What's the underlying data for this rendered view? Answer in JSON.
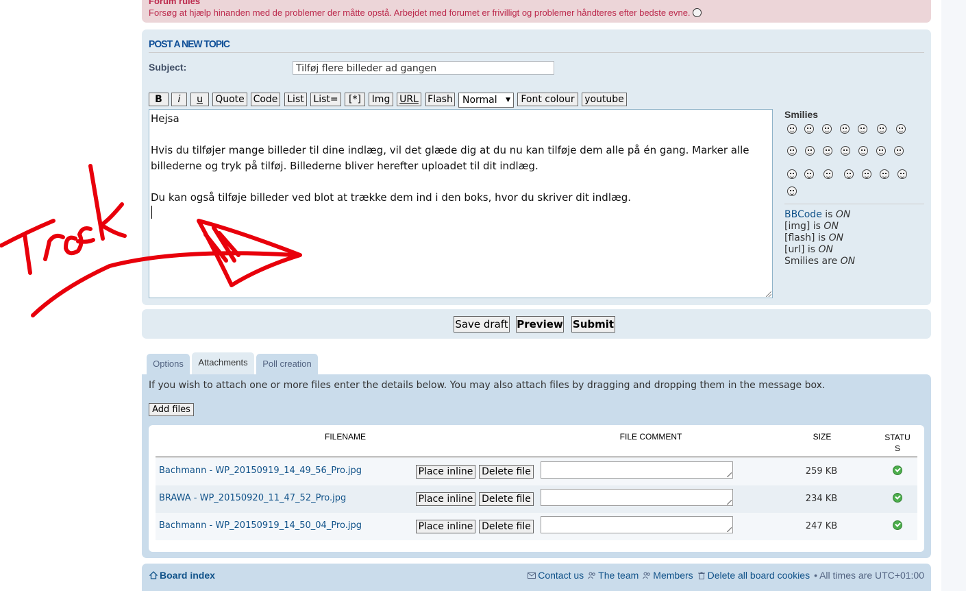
{
  "forum_rules": {
    "title": "Forum rules",
    "text": "Forsøg at hjælp hinanden med de problemer der måtte opstå. Arbejdet med forumet er frivilligt og problemer håndteres efter bedste evne."
  },
  "post": {
    "title": "POST A NEW TOPIC",
    "subject_label": "Subject:",
    "subject_value": "Tilføj flere billeder ad gangen",
    "toolbar": {
      "bold": "B",
      "italic": "i",
      "underline": "u",
      "quote": "Quote",
      "code": "Code",
      "list": "List",
      "list_ordered": "List=",
      "list_item": "[*]",
      "img": "Img",
      "url": "URL",
      "flash": "Flash",
      "font_size": "Normal",
      "font_colour": "Font colour",
      "youtube": "youtube"
    },
    "message_lines": [
      "Hejsa",
      "Hvis du tilføjer mange billeder til dine indlæg, vil det glæde dig at du nu kan tilføje dem alle på én gang. Marker alle",
      "billederne og tryk på tilføj. Billederne bliver herefter uploadet til dit indlæg.",
      "Du kan også tilføje billeder ved blot at trække dem ind i den boks, hvor du skriver dit indlæg."
    ],
    "smilies_title": "Smilies",
    "status": {
      "bbcode": "BBCode",
      "bbcode_suffix": " is ",
      "bbcode_state": "ON",
      "img": "[img] is ",
      "img_state": "ON",
      "flash": "[flash] is ",
      "flash_state": "ON",
      "url": "[url] is ",
      "url_state": "ON",
      "smilies": "Smilies are ",
      "smilies_state": "ON"
    }
  },
  "submit": {
    "save_draft": "Save draft",
    "preview": "Preview",
    "submit": "Submit"
  },
  "tabs": [
    "Options",
    "Attachments",
    "Poll creation"
  ],
  "attachments": {
    "info": "If you wish to attach one or more files enter the details below. You may also attach files by dragging and dropping them in the message box.",
    "add_files": "Add files",
    "headers": {
      "filename": "FILENAME",
      "comment": "FILE COMMENT",
      "size": "SIZE",
      "status": "STATU",
      "status2": "S"
    },
    "place_inline": "Place inline",
    "delete_file": "Delete file",
    "files": [
      {
        "name": "Bachmann - WP_20150919_14_49_56_Pro.jpg",
        "size": "259 KB"
      },
      {
        "name": "BRAWA - WP_20150920_11_47_52_Pro.jpg",
        "size": "234 KB"
      },
      {
        "name": "Bachmann - WP_20150919_14_50_04_Pro.jpg",
        "size": "247 KB"
      }
    ]
  },
  "footer": {
    "board_index": "Board index",
    "contact": "Contact us",
    "team": "The team",
    "members": "Members",
    "delete_cookies": "Delete all board cookies",
    "times": "• All times are UTC+01:00"
  },
  "annotation": {
    "text": "Træk",
    "color": "#e8000b"
  }
}
